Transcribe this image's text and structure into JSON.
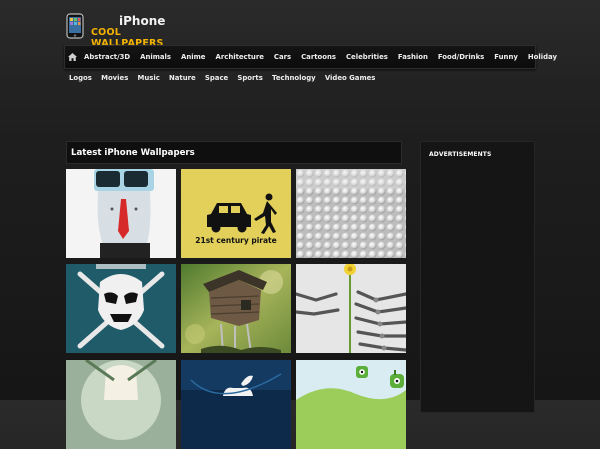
{
  "logo": {
    "top": "iPhone",
    "bottom": "COOL WALLPAPERS"
  },
  "nav": {
    "row1": [
      "Abstract/3D",
      "Animals",
      "Anime",
      "Architecture",
      "Cars",
      "Cartoons",
      "Celebrities",
      "Fashion",
      "Food/Drinks",
      "Funny",
      "Holiday"
    ],
    "row2": [
      "Logos",
      "Movies",
      "Music",
      "Nature",
      "Space",
      "Sports",
      "Technology",
      "Video Games"
    ]
  },
  "main": {
    "section_title": "Latest iPhone Wallpapers"
  },
  "thumbs": {
    "pirate_caption": "21st century pirate"
  },
  "sidebar": {
    "title": "ADVERTISEMENTS"
  },
  "colors": {
    "accent": "#f4b400",
    "nav_bg": "#101010",
    "background": "#1e1e1e"
  },
  "icons": {
    "home": "home-icon",
    "logo": "iphone-logo-icon"
  }
}
